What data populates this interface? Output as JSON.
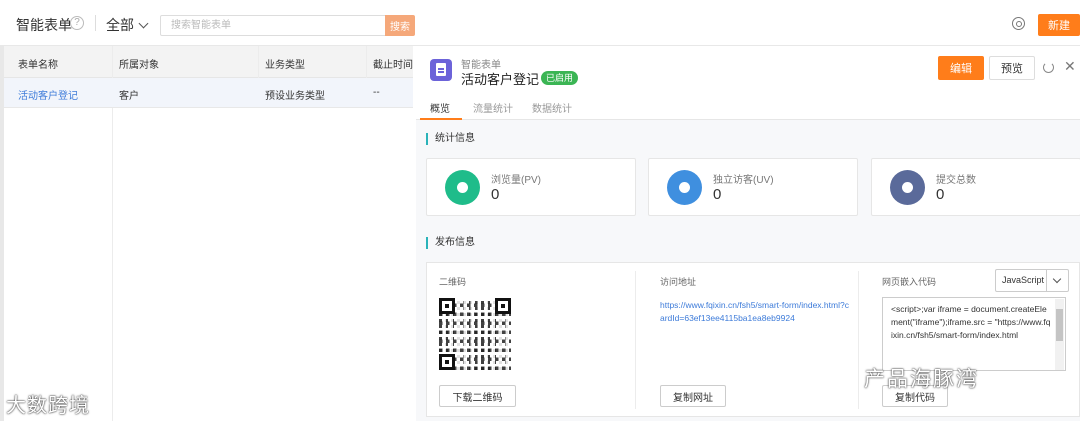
{
  "header": {
    "app_title": "智能表单",
    "help_glyph": "?",
    "filter_label": "全部",
    "search_placeholder": "搜索智能表单",
    "search_button": "搜索",
    "new_button": "新建"
  },
  "table": {
    "columns": [
      "表单名称",
      "所属对象",
      "业务类型",
      "截止时间"
    ],
    "rows": [
      {
        "name": "活动客户登记",
        "object": "客户",
        "biz_type": "预设业务类型",
        "deadline": "--"
      }
    ]
  },
  "detail": {
    "form_type": "智能表单",
    "form_name": "活动客户登记",
    "status": "已启用",
    "edit_button": "编辑",
    "preview_button": "预览",
    "close_glyph": "✕",
    "tabs": [
      {
        "label": "概览",
        "active": true
      },
      {
        "label": "流量统计",
        "active": false
      },
      {
        "label": "数据统计",
        "active": false
      }
    ],
    "stats_title": "统计信息",
    "stats": [
      {
        "label": "浏览量(PV)",
        "value": "0",
        "color": "#1fbc8a",
        "icon": "eye-icon"
      },
      {
        "label": "独立访客(UV)",
        "value": "0",
        "color": "#3f8fdf",
        "icon": "footprint-icon"
      },
      {
        "label": "提交总数",
        "value": "0",
        "color": "#5a6a9a",
        "icon": "submit-icon"
      }
    ],
    "publish_title": "发布信息",
    "publish": {
      "qr_label": "二维码",
      "qr_download": "下载二维码",
      "url_label": "访问地址",
      "url": "https://www.fqixin.cn/fsh5/smart-form/index.html?cardId=63ef13ee4115ba1ea8eb9924",
      "copy_url": "复制网址",
      "embed_label": "网页嵌入代码",
      "embed_lang": "JavaScript",
      "embed_code": "<script>;var iframe = document.createElement(\"iframe\");iframe.src = \"https://www.fqixin.cn/fsh5/smart-form/index.html",
      "copy_code": "复制代码"
    }
  },
  "watermarks": {
    "left": "大数跨境",
    "right": "产品海豚湾"
  },
  "colors": {
    "accent": "#ff7d1a",
    "link": "#3d7bd9",
    "status_green": "#3bb554",
    "section_bar": "#2ab3b9"
  }
}
